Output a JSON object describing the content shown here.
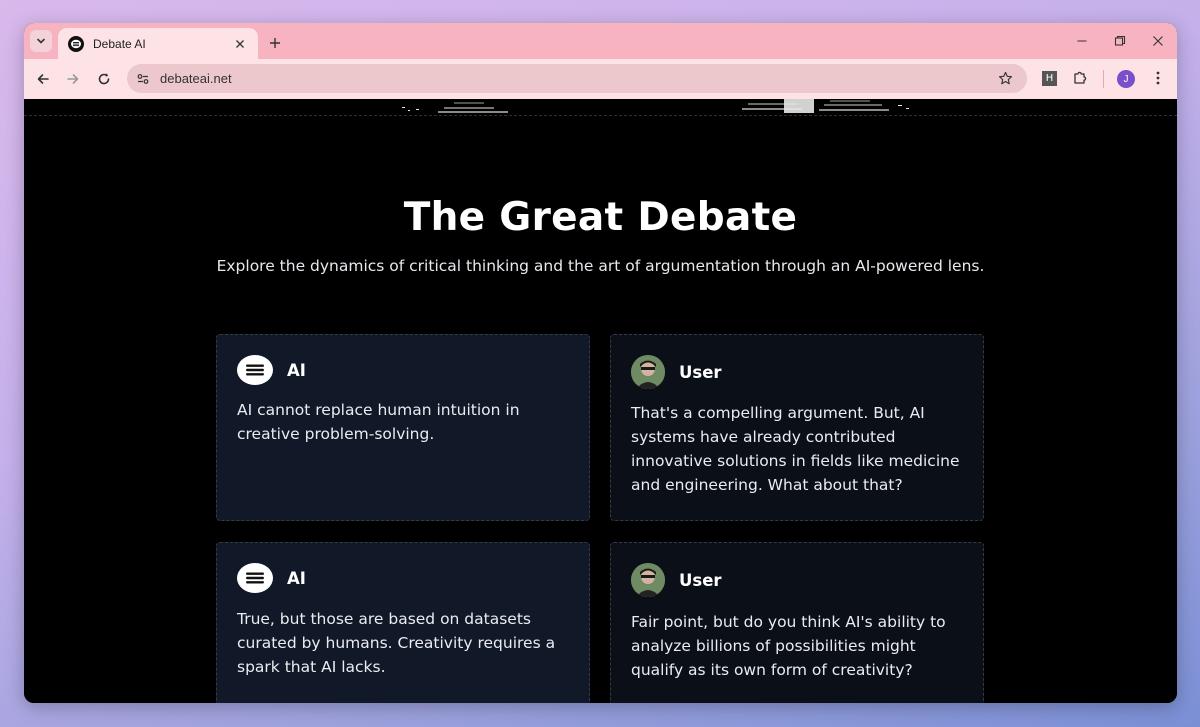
{
  "browser": {
    "tab_title": "Debate AI",
    "url": "debateai.net",
    "extension_label": "H",
    "profile_initial": "J"
  },
  "page": {
    "headline": "The Great Debate",
    "subheadline": "Explore the dynamics of critical thinking and the art of argumentation through an AI-powered lens.",
    "cards": [
      {
        "speaker": "AI",
        "text": "AI cannot replace human intuition in creative problem-solving."
      },
      {
        "speaker": "User",
        "text": "That's a compelling argument. But, AI systems have already contributed innovative solutions in fields like medicine and engineering. What about that?"
      },
      {
        "speaker": "AI",
        "text": "True, but those are based on datasets curated by humans. Creativity requires a spark that AI lacks."
      },
      {
        "speaker": "User",
        "text": "Fair point, but do you think AI's ability to analyze billions of possibilities might qualify as its own form of creativity?"
      }
    ]
  },
  "colors": {
    "tabstrip": "#f7b4c0",
    "toolbar": "#fde3e6",
    "page_background": "#000000",
    "ai_card": "#111827",
    "user_card": "#0b0f17",
    "profile": "#7a4fc9"
  },
  "icons": {
    "tab_search": "chevron-down-icon",
    "favicon": "debate-ai-logo-icon",
    "tab_close": "close-icon",
    "new_tab": "plus-icon",
    "minimize": "minimize-icon",
    "restore": "restore-icon",
    "close_window": "close-icon",
    "back": "arrow-left-icon",
    "forward": "arrow-right-icon",
    "reload": "reload-icon",
    "site_info": "tune-icon",
    "bookmark": "star-icon",
    "extensions": "puzzle-icon",
    "menu": "kebab-menu-icon"
  }
}
